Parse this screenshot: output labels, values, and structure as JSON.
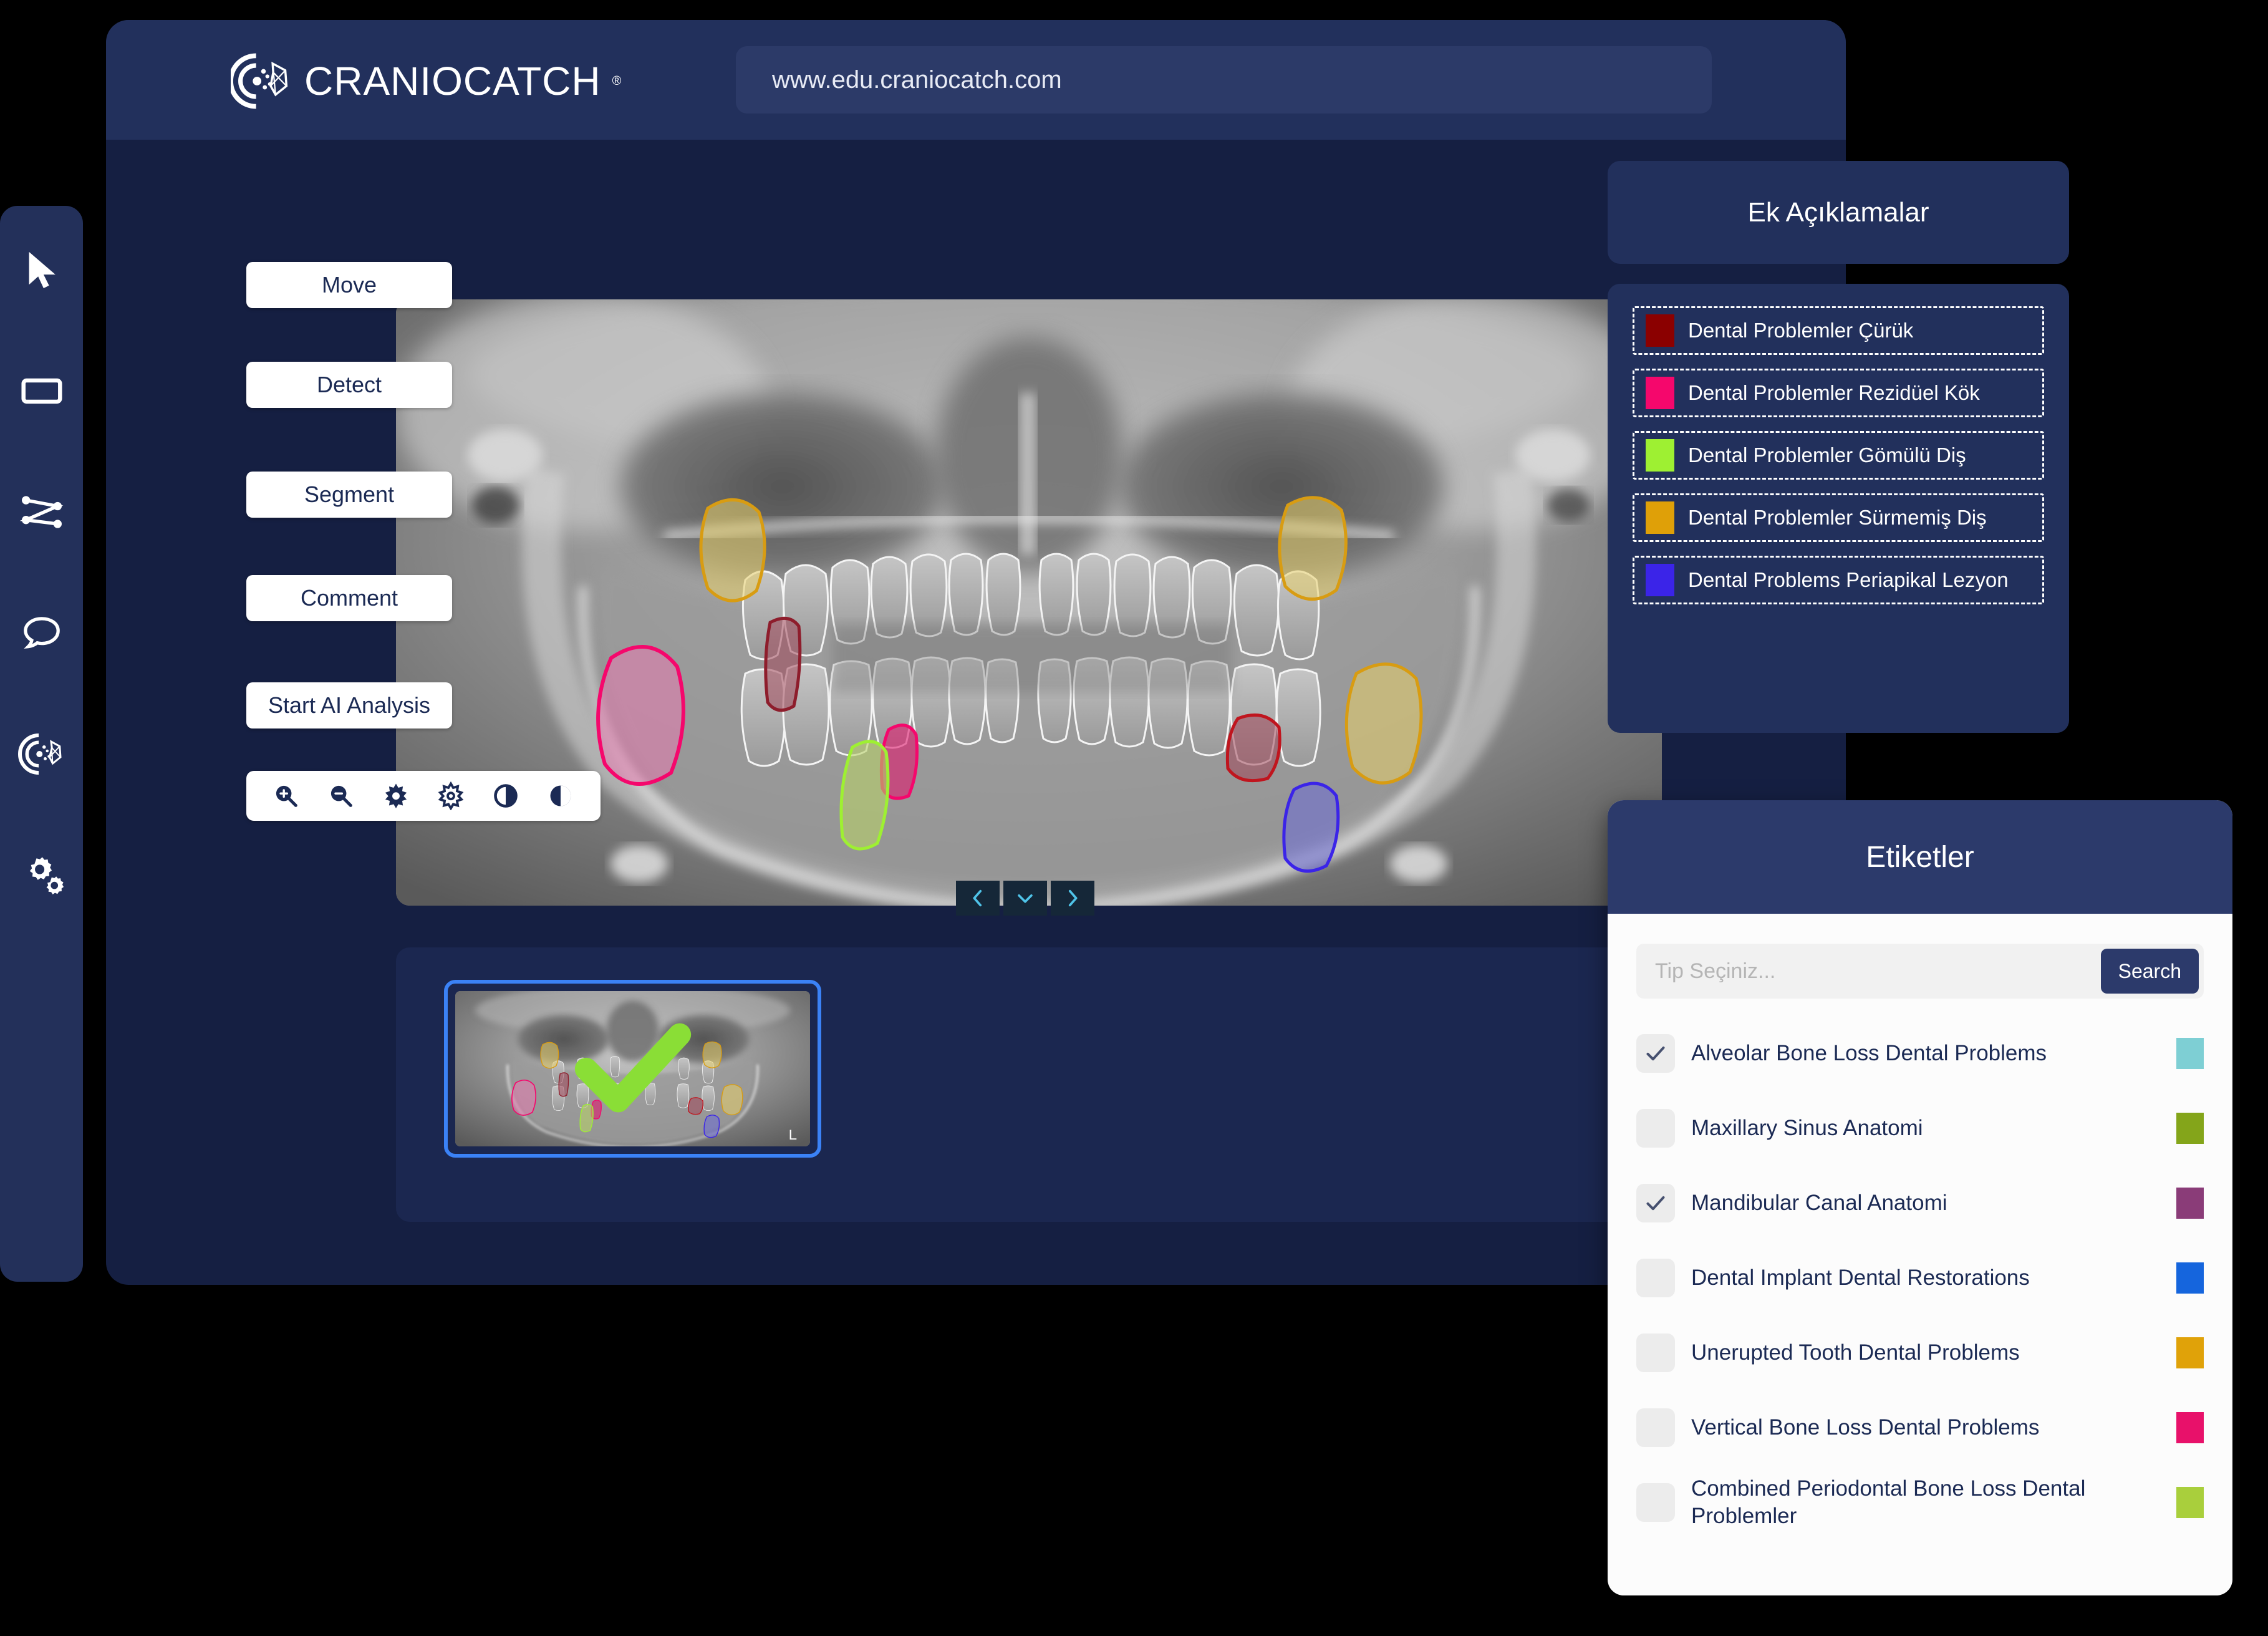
{
  "brand": {
    "name": "CRANIOCATCH",
    "registered": "®"
  },
  "urlbar": {
    "value": "www.edu.craniocatch.com"
  },
  "sidebar": {
    "items": [
      {
        "name": "cursor-icon",
        "label": "Select"
      },
      {
        "name": "rectangle-icon",
        "label": "Rectangle"
      },
      {
        "name": "polyline-icon",
        "label": "Polyline"
      },
      {
        "name": "comment-bubble-icon",
        "label": "Comment"
      },
      {
        "name": "craniocatch-ai-icon",
        "label": "AI"
      },
      {
        "name": "gears-icon",
        "label": "Settings"
      }
    ]
  },
  "tools": {
    "buttons": [
      {
        "label": "Move"
      },
      {
        "label": "Detect"
      },
      {
        "label": "Segment"
      },
      {
        "label": "Comment"
      },
      {
        "label": "Start AI Analysis"
      }
    ]
  },
  "image_toolbar": {
    "buttons": [
      {
        "name": "zoom-in-icon",
        "label": "Zoom In"
      },
      {
        "name": "zoom-out-icon",
        "label": "Zoom Out"
      },
      {
        "name": "brightness-icon",
        "label": "Brightness"
      },
      {
        "name": "contrast-gear-icon",
        "label": "Sharpness"
      },
      {
        "name": "contrast-half-icon",
        "label": "Contrast"
      },
      {
        "name": "invert-icon",
        "label": "Invert"
      }
    ]
  },
  "pager": {
    "prev": "‹",
    "down": "⌄",
    "next": "›"
  },
  "viewer": {
    "orientation_marker": "L"
  },
  "annotations_panel": {
    "title": "Ek Açıklamalar",
    "legend": [
      {
        "label": "Dental Problemler Çürük",
        "color": "#8b0000"
      },
      {
        "label": "Dental Problemler Rezidüel Kök",
        "color": "#f5076c"
      },
      {
        "label": "Dental Problemler Gömülü Diş",
        "color": "#9ef032"
      },
      {
        "label": "Dental Problemler Sürmemiş Diş",
        "color": "#dfa008"
      },
      {
        "label": "Dental Problems Periapikal Lezyon",
        "color": "#3b24e8"
      }
    ]
  },
  "labels_panel": {
    "title": "Etiketler",
    "search": {
      "placeholder": "Tip Seçiniz...",
      "value": "",
      "button": "Search"
    },
    "tags": [
      {
        "label": "Alveolar Bone Loss Dental Problems",
        "color": "#7ecfd4",
        "checked": true
      },
      {
        "label": "Maxillary Sinus Anatomi",
        "color": "#84a51a",
        "checked": false
      },
      {
        "label": "Mandibular Canal Anatomi",
        "color": "#8a3c78",
        "checked": true
      },
      {
        "label": "Dental Implant Dental Restorations",
        "color": "#1565dd",
        "checked": false
      },
      {
        "label": "Unerupted Tooth Dental Problems",
        "color": "#e0a209",
        "checked": false
      },
      {
        "label": "Vertical Bone Loss Dental Problems",
        "color": "#e8116a",
        "checked": false
      },
      {
        "label": "Combined Periodontal Bone Loss Dental Problemler",
        "color": "#a9cf3c",
        "checked": false
      }
    ]
  },
  "xray_markings": [
    {
      "name": "upper-left-unerupted",
      "color": "#e8cf6a",
      "stroke": "#d89c12"
    },
    {
      "name": "upper-right-unerupted",
      "color": "#e8cf6a",
      "stroke": "#d89c12"
    },
    {
      "name": "lower-right-unerupted",
      "color": "#e8cf6a",
      "stroke": "#d89c12"
    },
    {
      "name": "left-residual-root",
      "color": "#a0475a",
      "stroke": "#8e1d2c"
    },
    {
      "name": "right-caries",
      "color": "#a0475a",
      "stroke": "#c0151e"
    },
    {
      "name": "pink-lesion-large",
      "color": "#e87bb0",
      "stroke": "#f5076c"
    },
    {
      "name": "pink-lesion-small",
      "color": "#e01a6e",
      "stroke": "#f5076c"
    },
    {
      "name": "green-impacted",
      "color": "#b8d169",
      "stroke": "#9ef032"
    },
    {
      "name": "blue-periapical",
      "color": "#6f6fd1",
      "stroke": "#3b24e8"
    }
  ],
  "thumbnail": {
    "selected": true,
    "check_color": "#8ade36"
  }
}
